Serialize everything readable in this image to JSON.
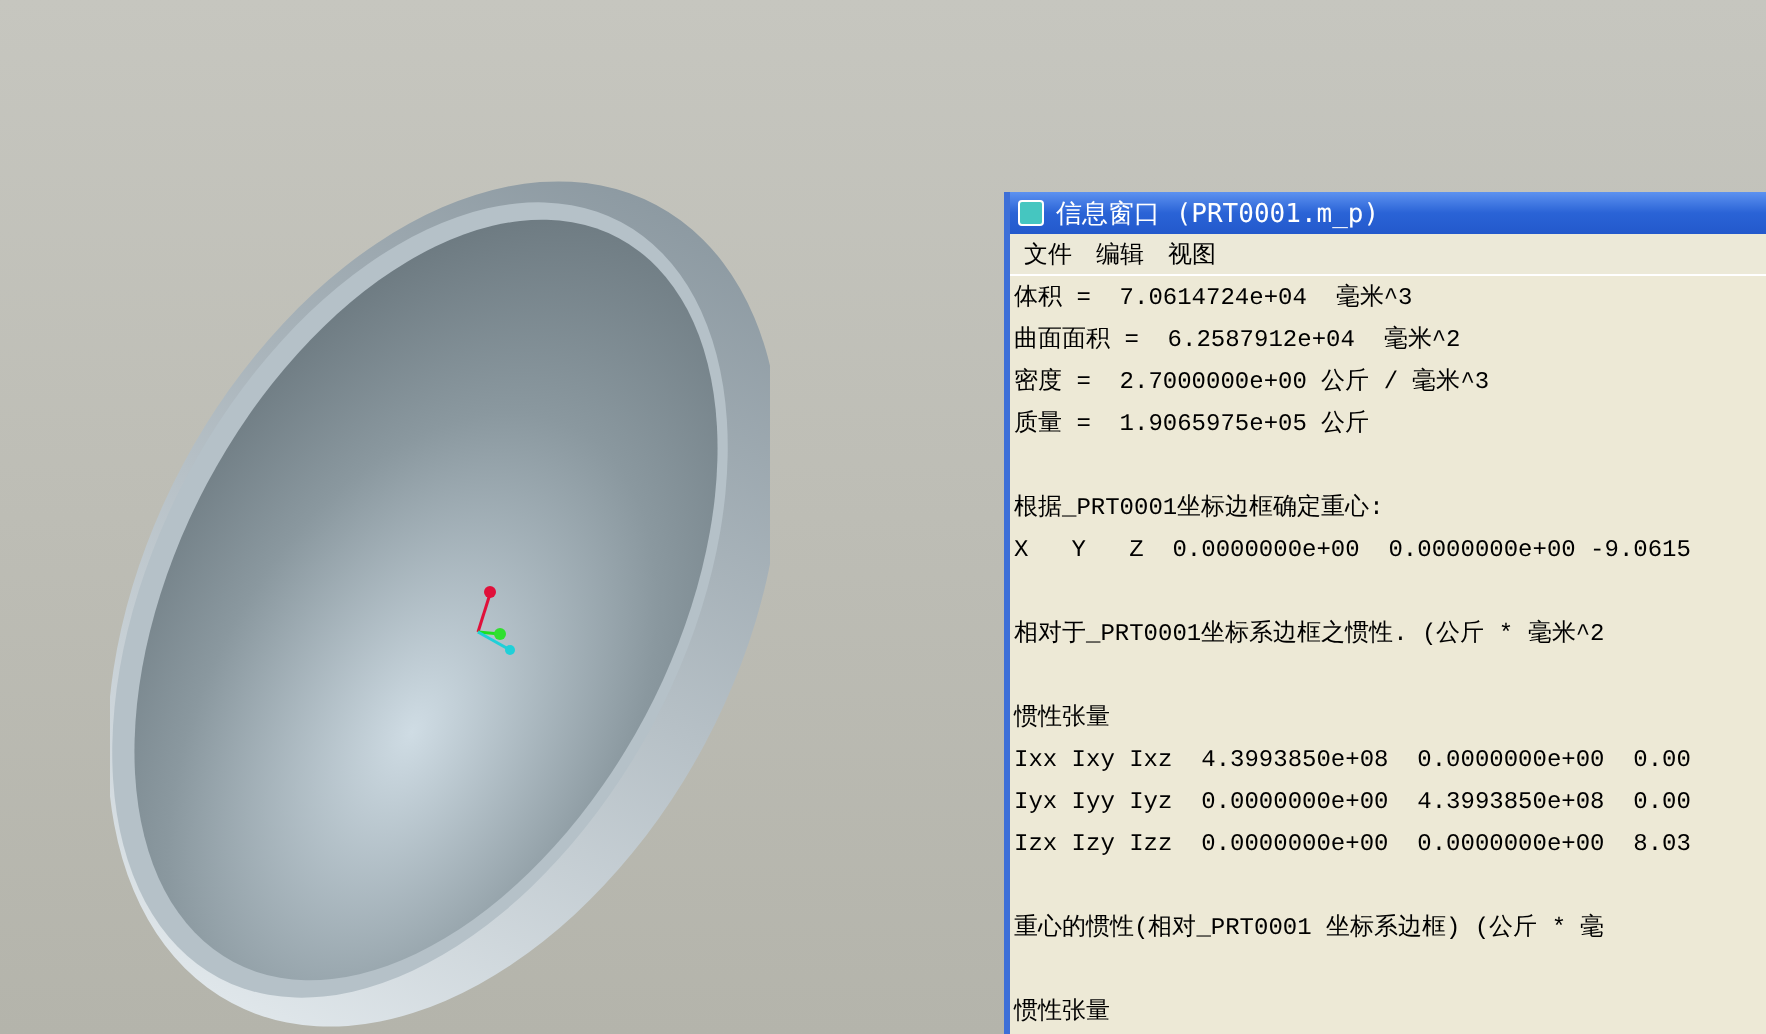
{
  "info_window": {
    "title": "信息窗口 (PRT0001.m_p)",
    "menu": [
      "文件",
      "编辑",
      "视图"
    ],
    "blocks": [
      {
        "lines": [
          "体积 =  7.0614724e+04  毫米^3",
          "曲面面积 =  6.2587912e+04  毫米^2",
          "密度 =  2.7000000e+00 公斤 / 毫米^3",
          "质量 =  1.9065975e+05 公斤"
        ]
      },
      {
        "lines": [
          "根据_PRT0001坐标边框确定重心:",
          "X   Y   Z  0.0000000e+00  0.0000000e+00 -9.0615"
        ]
      },
      {
        "lines": [
          "相对于_PRT0001坐标系边框之惯性. (公斤 * 毫米^2"
        ]
      },
      {
        "lines": [
          "惯性张量",
          "Ixx Ixy Ixz  4.3993850e+08  0.0000000e+00  0.00",
          "Iyx Iyy Iyz  0.0000000e+00  4.3993850e+08  0.00",
          "Izx Izy Izz  0.0000000e+00  0.0000000e+00  8.03"
        ]
      },
      {
        "lines": [
          "重心的惯性(相对_PRT0001 坐标系边框) (公斤 * 毫"
        ]
      },
      {
        "lines": [
          "惯性张量"
        ]
      }
    ]
  }
}
